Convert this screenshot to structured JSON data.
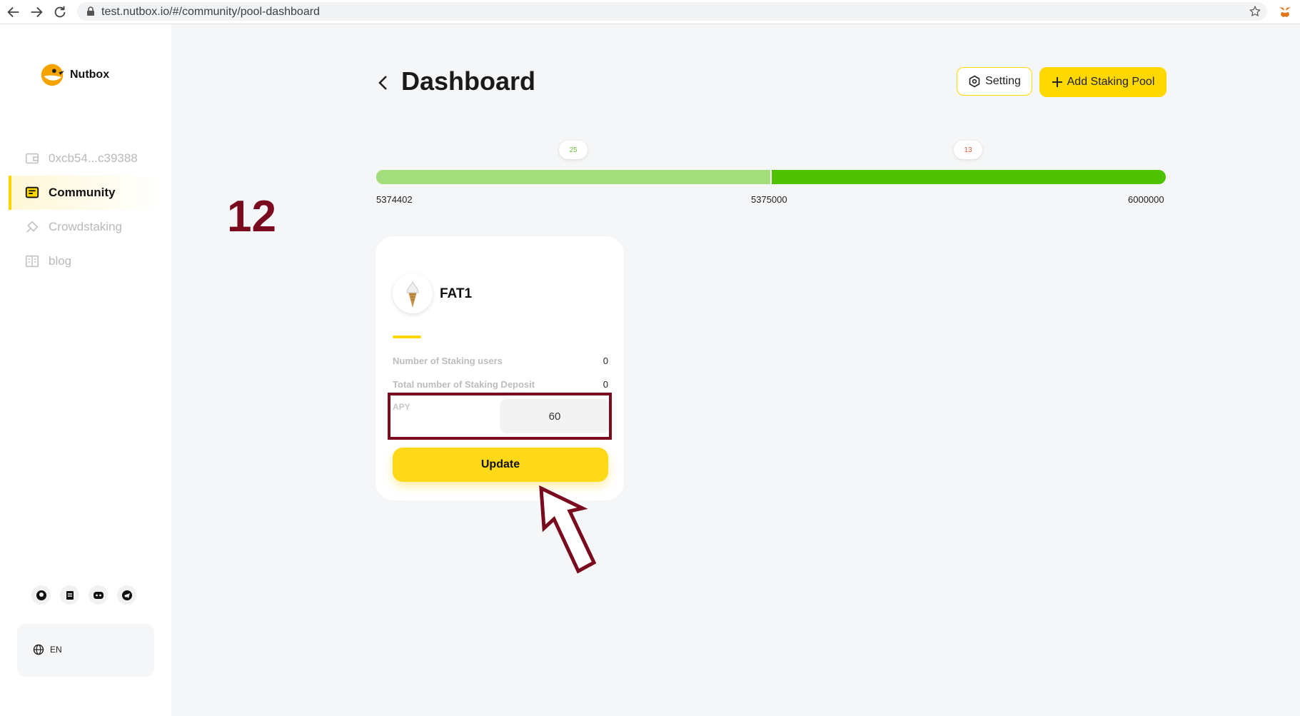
{
  "browser": {
    "url": "test.nutbox.io/#/community/pool-dashboard"
  },
  "sidebar": {
    "logo_text": "Nutbox",
    "items": [
      {
        "label": "0xcb54...c39388",
        "icon": "wallet-icon",
        "active": false
      },
      {
        "label": "Community",
        "icon": "community-icon",
        "active": true
      },
      {
        "label": "Crowdstaking",
        "icon": "crowdstaking-icon",
        "active": false
      },
      {
        "label": "blog",
        "icon": "blog-icon",
        "active": false
      }
    ],
    "social": [
      "github-icon",
      "docs-icon",
      "discord-icon",
      "telegram-icon"
    ],
    "language": "EN"
  },
  "header": {
    "title": "Dashboard",
    "setting_label": "Setting",
    "add_pool_label": "Add Staking Pool"
  },
  "progress": {
    "start_block": "5374402",
    "mid_block": "5375000",
    "end_block": "6000000",
    "stage1_value": "25",
    "stage2_value": "13",
    "filled_fraction": 0.5,
    "colors": {
      "stage1": "#a4dd7c",
      "stage2": "#4fc301"
    }
  },
  "annotation": {
    "step_number": "12"
  },
  "pool_card": {
    "token_name": "FAT1",
    "staking_users_label": "Number of Staking users",
    "staking_users_value": "0",
    "staking_deposit_label": "Total number of Staking Deposit",
    "staking_deposit_value": "0",
    "apy_label": "APY",
    "apy_value": "60",
    "update_label": "Update"
  },
  "colors": {
    "accent": "#ffd800",
    "annotation": "#7a0a1e"
  }
}
